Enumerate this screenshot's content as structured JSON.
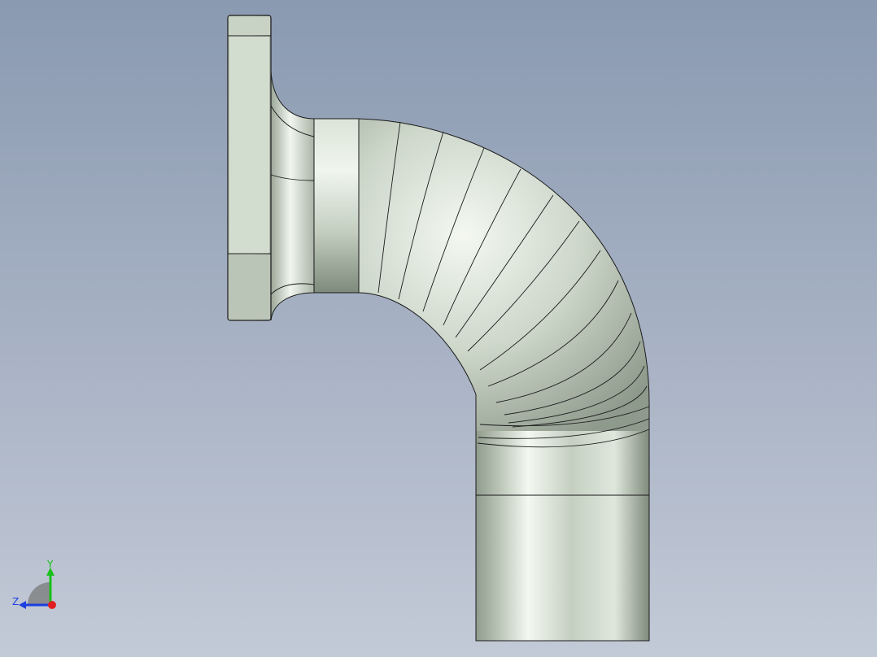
{
  "viewport": {
    "background_top": "#8a9ab1",
    "background_bottom": "#c3cad7"
  },
  "model": {
    "description_icon": "pipe-elbow-with-flange",
    "surface_color": "#c8d3c9",
    "edge_color": "#1a1a1a"
  },
  "triad": {
    "x_label": "",
    "y_label": "Y",
    "z_label": "Z",
    "x_color": "#e02020",
    "y_color": "#19c019",
    "z_color": "#1c3fe0"
  }
}
